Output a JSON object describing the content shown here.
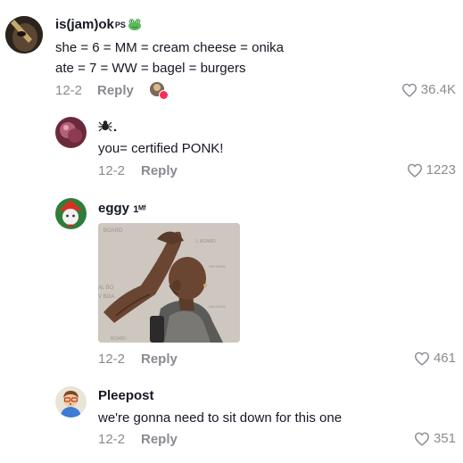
{
  "comments": [
    {
      "username": "is(jam)ok",
      "badge": "PS",
      "lines": [
        "she = 6 = MM = cream cheese = onika",
        "ate = 7 = WW = bagel = burgers"
      ],
      "date": "12-2",
      "reply_label": "Reply",
      "likes": "36.4K"
    },
    {
      "username": ".",
      "lines": [
        "you= certified PONK!"
      ],
      "date": "12-2",
      "reply_label": "Reply",
      "likes": "1223"
    },
    {
      "username": "eggy",
      "username_suffix": "1ᴹᶠ",
      "date": "12-2",
      "reply_label": "Reply",
      "likes": "461"
    },
    {
      "username": "Pleepost",
      "lines": [
        "we're gonna need to sit down for this one"
      ],
      "date": "12-2",
      "reply_label": "Reply",
      "likes": "351"
    }
  ],
  "colors": {
    "text": "#161823",
    "muted": "#8a8b91",
    "background": "#ffffff"
  },
  "icons": [
    "heart-icon",
    "frog-emoji-icon",
    "spider-icon"
  ]
}
